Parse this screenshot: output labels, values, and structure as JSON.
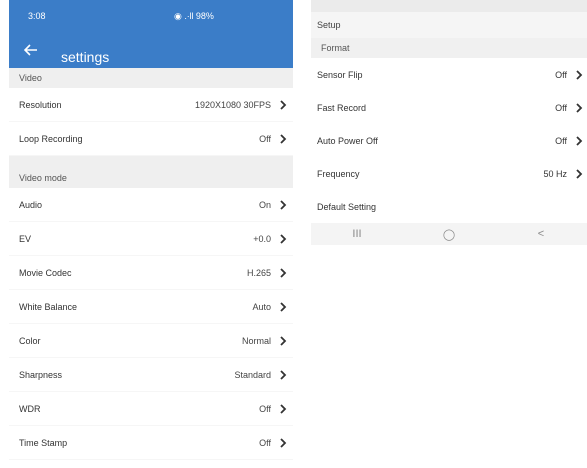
{
  "statusbar": {
    "time": "3:08",
    "right": "◉ .∙ll 98%"
  },
  "appbar": {
    "title": "settings"
  },
  "left": {
    "section_video": "Video",
    "rows_video": [
      {
        "label": "Resolution",
        "value": "1920X1080 30FPS"
      },
      {
        "label": "Loop Recording",
        "value": "Off"
      }
    ],
    "section_video_mode": "Video mode",
    "rows_mode": [
      {
        "label": "Audio",
        "value": "On"
      },
      {
        "label": "EV",
        "value": "+0.0"
      },
      {
        "label": "Movie Codec",
        "value": "H.265"
      },
      {
        "label": "White Balance",
        "value": "Auto"
      },
      {
        "label": "Color",
        "value": "Normal"
      },
      {
        "label": "Sharpness",
        "value": "Standard"
      },
      {
        "label": "WDR",
        "value": "Off"
      },
      {
        "label": "Time Stamp",
        "value": "Off"
      }
    ]
  },
  "right": {
    "setup_label": "Setup",
    "format_label": "Format",
    "rows": [
      {
        "label": "Sensor Flip",
        "value": "Off"
      },
      {
        "label": "Fast Record",
        "value": "Off"
      },
      {
        "label": "Auto Power Off",
        "value": "Off"
      },
      {
        "label": "Frequency",
        "value": "50 Hz"
      }
    ],
    "default_setting": "Default Setting"
  },
  "navbar": {
    "recent": "III",
    "home": "◯",
    "back": "<"
  },
  "colors": {
    "appbar": "#3b7dc8",
    "section_bg": "#efefef"
  }
}
